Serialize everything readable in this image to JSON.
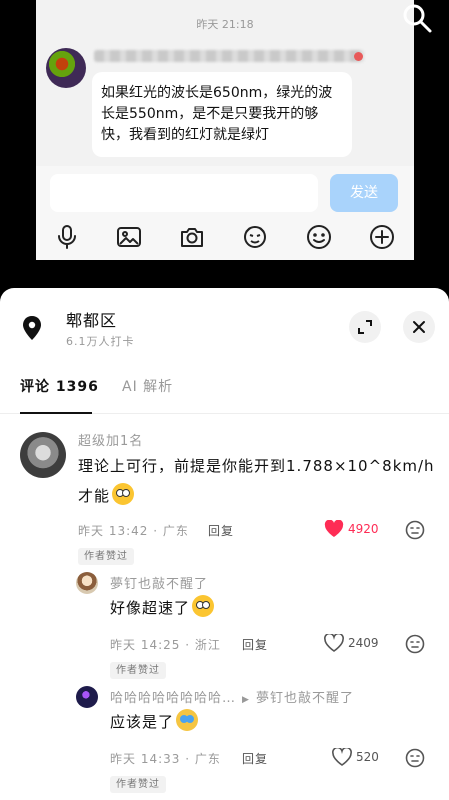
{
  "chat": {
    "time": "昨天 21:18",
    "message": "如果红光的波长是650nm，绿光的波长是550nm，是不是只要我开的够快，我看到的红灯就是绿灯",
    "send_label": "发送",
    "icons": [
      "mic-icon",
      "image-icon",
      "camera-icon",
      "sticker-icon",
      "emoji-icon",
      "add-icon"
    ]
  },
  "sheet": {
    "location": "郫都区",
    "checkins": "6.1万人打卡",
    "tabs": [
      {
        "label": "评论 1396",
        "active": true
      },
      {
        "label": "AI 解析",
        "active": false
      }
    ]
  },
  "comments": [
    {
      "username": "超级加1名",
      "text_line1": "理论上可行，前提是你能开到1.788×10^8km/h",
      "text_line2": "才能",
      "emoji": "grin-emoji",
      "time": "昨天 13:42",
      "region": "广东",
      "reply_label": "回复",
      "likes": "4920",
      "liked": true,
      "badge": "作者赞过"
    }
  ],
  "replies": [
    {
      "username": "夢钉也敲不醒了",
      "text": "好像超速了",
      "emoji": "dizzy-emoji",
      "time": "昨天 14:25",
      "region": "浙江",
      "reply_label": "回复",
      "likes": "2409",
      "liked": false,
      "badge": "作者赞过"
    },
    {
      "username": "哈哈哈哈哈哈哈哈…",
      "reply_to": "夢钉也敲不醒了",
      "text": "应该是了",
      "emoji": "crying-laughing-emoji",
      "time": "昨天 14:33",
      "region": "广东",
      "reply_label": "回复",
      "likes": "520",
      "liked": false,
      "badge": "作者赞过"
    }
  ],
  "colors": {
    "like_active": "#fe2c55",
    "send_button": "#a9d3fb",
    "meta_text": "#9a9a9a"
  }
}
